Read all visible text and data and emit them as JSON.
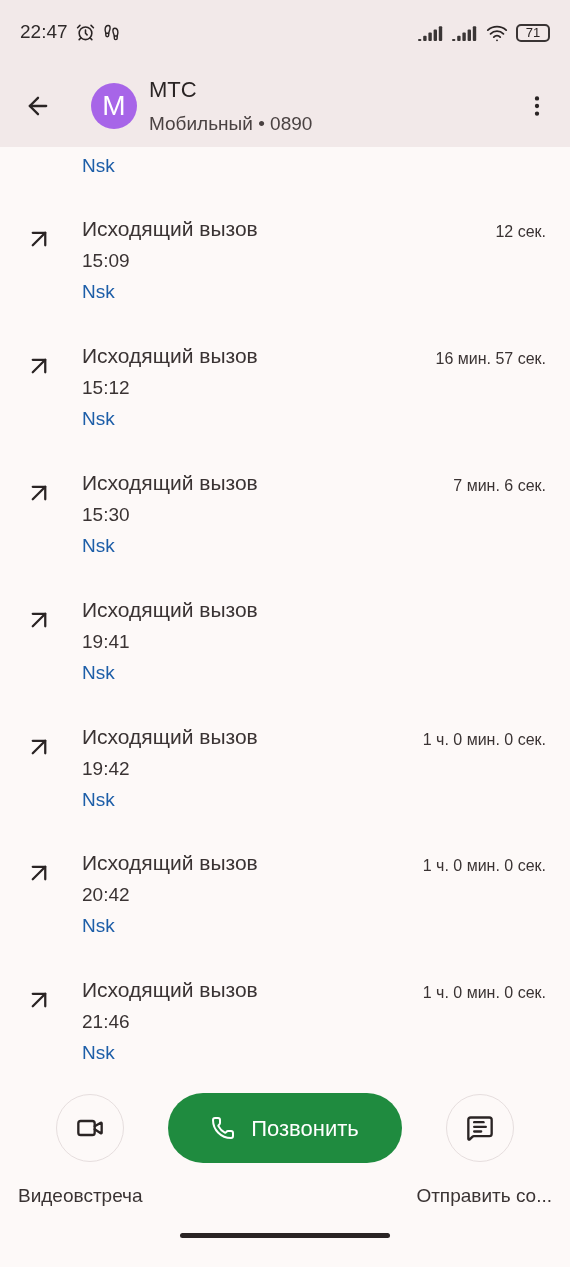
{
  "status_bar": {
    "time": "22:47",
    "battery": "71"
  },
  "app_bar": {
    "avatar_letter": "M",
    "name": "МТС",
    "subtitle": "Мобильный • 0890"
  },
  "partial_location": "Nsk",
  "calls": [
    {
      "type": "Исходящий вызов",
      "time": "15:09",
      "location": "Nsk",
      "duration": "12 сек."
    },
    {
      "type": "Исходящий вызов",
      "time": "15:12",
      "location": "Nsk",
      "duration": "16 мин. 57 сек."
    },
    {
      "type": "Исходящий вызов",
      "time": "15:30",
      "location": "Nsk",
      "duration": "7 мин. 6 сек."
    },
    {
      "type": "Исходящий вызов",
      "time": "19:41",
      "location": "Nsk"
    },
    {
      "type": "Исходящий вызов",
      "time": "19:42",
      "location": "Nsk",
      "duration": "1 ч. 0 мин. 0 сек."
    },
    {
      "type": "Исходящий вызов",
      "time": "20:42",
      "location": "Nsk",
      "duration": "1 ч. 0 мин. 0 сек."
    },
    {
      "type": "Исходящий вызов",
      "time": "21:46",
      "location": "Nsk",
      "duration": "1 ч. 0 мин. 0 сек."
    }
  ],
  "actions": {
    "video_label": "Видеовстреча",
    "call_button": "Позвонить",
    "message_label": "Отправить со..."
  }
}
